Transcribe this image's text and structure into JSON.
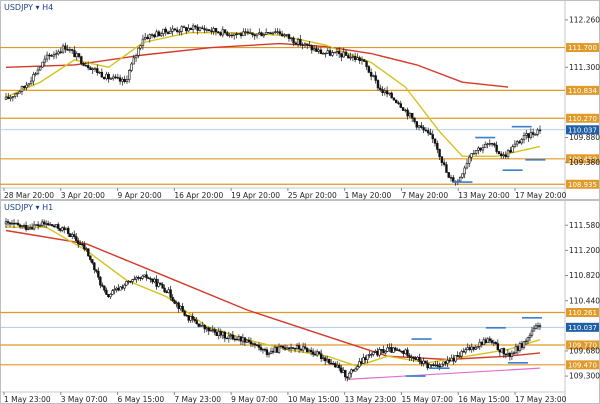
{
  "chart_data": [
    {
      "id": "h4",
      "type": "candlestick",
      "title": "USDJPY ▾ H4",
      "ylim": [
        108.9,
        112.5
      ],
      "y_ticks": [
        "112.260",
        "111.700",
        "111.300",
        "110.834",
        "110.270",
        "110.037",
        "109.880",
        "109.450",
        "109.380",
        "108.935"
      ],
      "x_ticks": [
        "28 Mar 20:00",
        "3 Apr 20:00",
        "9 Apr 20:00",
        "16 Apr 20:00",
        "19 Apr 20:00",
        "25 Apr 20:00",
        "1 May 20:00",
        "7 May 20:00",
        "13 May 20:00",
        "17 May 20:00"
      ],
      "hlines": [
        {
          "value": 111.7,
          "label": "111.700",
          "color": "#e09a2a"
        },
        {
          "value": 110.834,
          "label": "110.834",
          "color": "#e09a2a"
        },
        {
          "value": 110.27,
          "label": "110.270",
          "color": "#e09a2a"
        },
        {
          "value": 110.037,
          "label": "110.037",
          "color": "#9ec3e6"
        },
        {
          "value": 109.45,
          "label": "109.450",
          "color": "#e09a2a"
        },
        {
          "value": 108.935,
          "label": "108.935",
          "color": "#e09a2a"
        }
      ],
      "price_anchors": [
        [
          0,
          110.65
        ],
        [
          8,
          110.9
        ],
        [
          18,
          111.5
        ],
        [
          26,
          111.72
        ],
        [
          34,
          111.4
        ],
        [
          44,
          111.1
        ],
        [
          52,
          111.0
        ],
        [
          60,
          111.9
        ],
        [
          72,
          112.05
        ],
        [
          84,
          112.1
        ],
        [
          96,
          112.0
        ],
        [
          108,
          111.95
        ],
        [
          118,
          112.05
        ],
        [
          126,
          111.85
        ],
        [
          138,
          111.6
        ],
        [
          148,
          111.55
        ],
        [
          156,
          111.45
        ],
        [
          164,
          110.85
        ],
        [
          172,
          110.6
        ],
        [
          180,
          110.15
        ],
        [
          188,
          109.8
        ],
        [
          194,
          109.05
        ],
        [
          198,
          109.0
        ],
        [
          204,
          109.6
        ],
        [
          212,
          109.75
        ],
        [
          218,
          109.5
        ],
        [
          226,
          109.85
        ],
        [
          234,
          110.05
        ]
      ],
      "ma_slow": [
        [
          0,
          111.3
        ],
        [
          30,
          111.35
        ],
        [
          60,
          111.55
        ],
        [
          90,
          111.7
        ],
        [
          120,
          111.78
        ],
        [
          140,
          111.72
        ],
        [
          160,
          111.58
        ],
        [
          180,
          111.35
        ],
        [
          200,
          111.0
        ],
        [
          220,
          110.9
        ]
      ],
      "ma_fast": [
        [
          0,
          110.7
        ],
        [
          15,
          111.0
        ],
        [
          30,
          111.45
        ],
        [
          45,
          111.3
        ],
        [
          60,
          111.8
        ],
        [
          80,
          112.0
        ],
        [
          100,
          112.0
        ],
        [
          120,
          111.95
        ],
        [
          140,
          111.75
        ],
        [
          160,
          111.4
        ],
        [
          175,
          110.9
        ],
        [
          190,
          110.0
        ],
        [
          200,
          109.5
        ],
        [
          215,
          109.5
        ],
        [
          234,
          109.7
        ]
      ],
      "markers": [
        {
          "x": 200,
          "value": 108.98,
          "color": "#3a7fd0"
        },
        {
          "x": 210,
          "value": 109.88,
          "color": "#3a7fd0"
        },
        {
          "x": 222,
          "value": 109.22,
          "color": "#3a7fd0"
        },
        {
          "x": 226,
          "value": 110.1,
          "color": "#3a7fd0"
        },
        {
          "x": 232,
          "value": 109.43,
          "color": "#3a7fd0"
        }
      ]
    },
    {
      "id": "h1",
      "type": "candlestick",
      "title": "USDJPY ▾ H1",
      "ylim": [
        109.15,
        111.75
      ],
      "y_ticks": [
        "111.580",
        "111.200",
        "110.820",
        "110.440",
        "110.261",
        "110.037",
        "109.770",
        "109.680",
        "109.470",
        "109.300"
      ],
      "x_ticks": [
        "1 May 23:00",
        "3 May 07:00",
        "6 May 15:00",
        "7 May 23:00",
        "9 May 07:00",
        "10 May 15:00",
        "13 May 23:00",
        "15 May 07:00",
        "16 May 15:00",
        "17 May 23:00"
      ],
      "hlines": [
        {
          "value": 110.261,
          "label": "110.261",
          "color": "#e09a2a"
        },
        {
          "value": 110.037,
          "label": "110.037",
          "color": "#9ec3e6"
        },
        {
          "value": 109.77,
          "label": "109.770",
          "color": "#e09a2a"
        },
        {
          "value": 109.47,
          "label": "109.470",
          "color": "#e09a2a"
        }
      ],
      "price_anchors": [
        [
          0,
          111.6
        ],
        [
          10,
          111.55
        ],
        [
          20,
          111.6
        ],
        [
          30,
          111.5
        ],
        [
          40,
          111.2
        ],
        [
          50,
          110.5
        ],
        [
          60,
          110.7
        ],
        [
          70,
          110.8
        ],
        [
          80,
          110.6
        ],
        [
          90,
          110.2
        ],
        [
          100,
          110.0
        ],
        [
          110,
          109.9
        ],
        [
          120,
          109.85
        ],
        [
          130,
          109.65
        ],
        [
          140,
          109.75
        ],
        [
          150,
          109.7
        ],
        [
          160,
          109.55
        ],
        [
          170,
          109.3
        ],
        [
          180,
          109.6
        ],
        [
          190,
          109.7
        ],
        [
          200,
          109.65
        ],
        [
          210,
          109.45
        ],
        [
          220,
          109.5
        ],
        [
          230,
          109.7
        ],
        [
          240,
          109.85
        ],
        [
          250,
          109.6
        ],
        [
          258,
          109.8
        ],
        [
          266,
          110.1
        ]
      ],
      "ma_slow": [
        [
          0,
          111.5
        ],
        [
          40,
          111.3
        ],
        [
          80,
          110.8
        ],
        [
          120,
          110.3
        ],
        [
          160,
          109.9
        ],
        [
          190,
          109.6
        ],
        [
          220,
          109.55
        ],
        [
          250,
          109.6
        ],
        [
          266,
          109.65
        ]
      ],
      "ma_fast": [
        [
          0,
          111.55
        ],
        [
          20,
          111.55
        ],
        [
          40,
          111.2
        ],
        [
          60,
          110.75
        ],
        [
          80,
          110.5
        ],
        [
          100,
          110.05
        ],
        [
          120,
          109.85
        ],
        [
          140,
          109.7
        ],
        [
          160,
          109.6
        ],
        [
          175,
          109.45
        ],
        [
          190,
          109.6
        ],
        [
          210,
          109.5
        ],
        [
          230,
          109.6
        ],
        [
          250,
          109.7
        ],
        [
          266,
          109.85
        ]
      ],
      "trendline": [
        [
          170,
          109.25
        ],
        [
          266,
          109.42
        ]
      ],
      "markers": [
        {
          "x": 207,
          "value": 109.86,
          "color": "#3a7fd0"
        },
        {
          "x": 204,
          "value": 109.3,
          "color": "#3a7fd0"
        },
        {
          "x": 216,
          "value": 109.42,
          "color": "#3a7fd0"
        },
        {
          "x": 244,
          "value": 110.03,
          "color": "#3a7fd0"
        },
        {
          "x": 255,
          "value": 109.5,
          "color": "#3a7fd0"
        },
        {
          "x": 262,
          "value": 110.18,
          "color": "#3a7fd0"
        }
      ]
    }
  ]
}
